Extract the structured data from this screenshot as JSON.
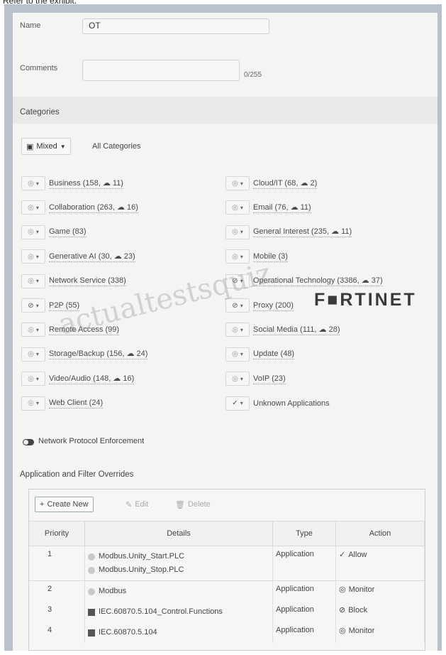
{
  "page_caption": "Refer to the exhibit.",
  "form": {
    "name_label": "Name",
    "name_value": "OT",
    "comments_label": "Comments",
    "comments_counter": "0/255"
  },
  "categories": {
    "title": "Categories",
    "mixed_button": "Mixed",
    "all_categories_label": "All Categories",
    "left": [
      {
        "label": "Business (158, ☁ 11)",
        "action": "monitor"
      },
      {
        "label": "Collaboration (263, ☁ 16)",
        "action": "monitor"
      },
      {
        "label": "Game (83)",
        "action": "monitor"
      },
      {
        "label": "Generative AI (30, ☁ 23)",
        "action": "monitor"
      },
      {
        "label": "Network Service (338)",
        "action": "monitor"
      },
      {
        "label": "P2P (55)",
        "action": "block"
      },
      {
        "label": "Remote Access (99)",
        "action": "monitor"
      },
      {
        "label": "Storage/Backup (156, ☁ 24)",
        "action": "monitor"
      },
      {
        "label": "Video/Audio (148, ☁ 16)",
        "action": "monitor"
      },
      {
        "label": "Web Client (24)",
        "action": "monitor"
      }
    ],
    "right": [
      {
        "label": "Cloud/IT (68, ☁ 2)",
        "action": "monitor"
      },
      {
        "label": "Email (76, ☁ 11)",
        "action": "monitor"
      },
      {
        "label": "General Interest (235, ☁ 11)",
        "action": "monitor"
      },
      {
        "label": "Mobile (3)",
        "action": "monitor"
      },
      {
        "label": "Operational Technology (3386, ☁ 37)",
        "action": "block"
      },
      {
        "label": "Proxy (200)",
        "action": "block"
      },
      {
        "label": "Social Media (111, ☁ 28)",
        "action": "monitor"
      },
      {
        "label": "Update (48)",
        "action": "monitor"
      },
      {
        "label": "VoIP (23)",
        "action": "monitor"
      },
      {
        "label": "Unknown Applications",
        "action": "allow"
      }
    ]
  },
  "watermark": "actualtestsquiz",
  "brand": "F■RTINET",
  "network_protocol_enforcement_label": "Network Protocol Enforcement",
  "overrides": {
    "title": "Application and Filter Overrides",
    "toolbar": {
      "create_new": "Create New",
      "edit": "Edit",
      "delete": "Delete"
    },
    "columns": [
      "Priority",
      "Details",
      "Type",
      "Action"
    ],
    "rows": [
      {
        "priority": "1",
        "details": [
          "Modbus.Unity_Start.PLC",
          "Modbus.Unity_Stop.PLC"
        ],
        "icon": "signature-icon",
        "type": "Application",
        "action_icon": "✓",
        "action": "Allow"
      },
      {
        "priority": "2",
        "details": [
          "Modbus"
        ],
        "icon": "signature-icon",
        "type": "Application",
        "action_icon": "◎",
        "action": "Monitor"
      },
      {
        "priority": "3",
        "details": [
          "IEC.60870.5.104_Control.Functions"
        ],
        "icon": "application-icon",
        "type": "Application",
        "action_icon": "⊘",
        "action": "Block"
      },
      {
        "priority": "4",
        "details": [
          "IEC.60870.5.104"
        ],
        "icon": "application-icon",
        "type": "Application",
        "action_icon": "◎",
        "action": "Monitor"
      }
    ]
  }
}
